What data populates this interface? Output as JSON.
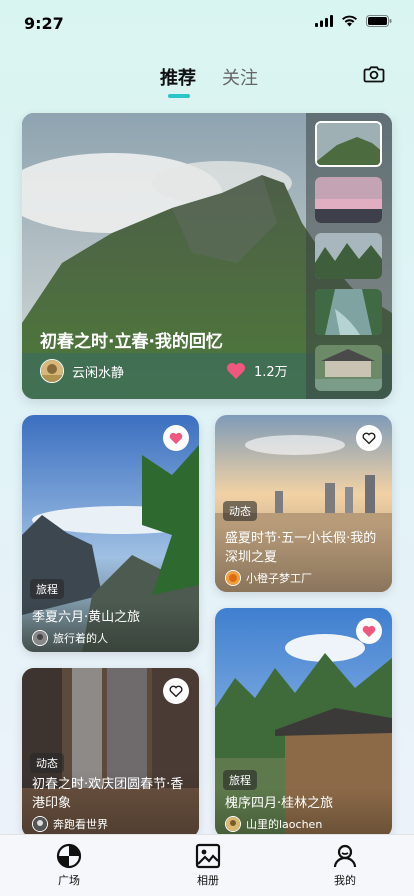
{
  "status": {
    "time": "9:27"
  },
  "tabs": [
    {
      "label": "推荐"
    },
    {
      "label": "关注"
    }
  ],
  "hero": {
    "title": "初春之时·立春·我的回忆",
    "author": "云闲水静",
    "likes": "1.2万"
  },
  "cards": [
    {
      "tag": "旅程",
      "title": "季夏六月·黄山之旅",
      "author": "旅行着的人",
      "liked": true
    },
    {
      "tag": "动态",
      "title": "盛夏时节·五一小长假·我的深圳之夏",
      "author": "小橙子梦工厂",
      "liked": false
    },
    {
      "tag": "动态",
      "title": "初春之时·欢庆团圆春节·香港印象",
      "author": "奔跑看世界",
      "liked": false
    },
    {
      "tag": "旅程",
      "title": "槐序四月·桂林之旅",
      "author": "山里的laochen",
      "liked": true
    }
  ],
  "nav": [
    {
      "label": "广场"
    },
    {
      "label": "相册"
    },
    {
      "label": "我的"
    }
  ],
  "icons": [
    "signal-icon",
    "wifi-icon",
    "battery-icon",
    "camera-icon",
    "heart-icon",
    "square-icon",
    "gallery-icon",
    "profile-icon"
  ],
  "colors": {
    "accent": "#29c6c9",
    "heart": "#f0577f"
  }
}
